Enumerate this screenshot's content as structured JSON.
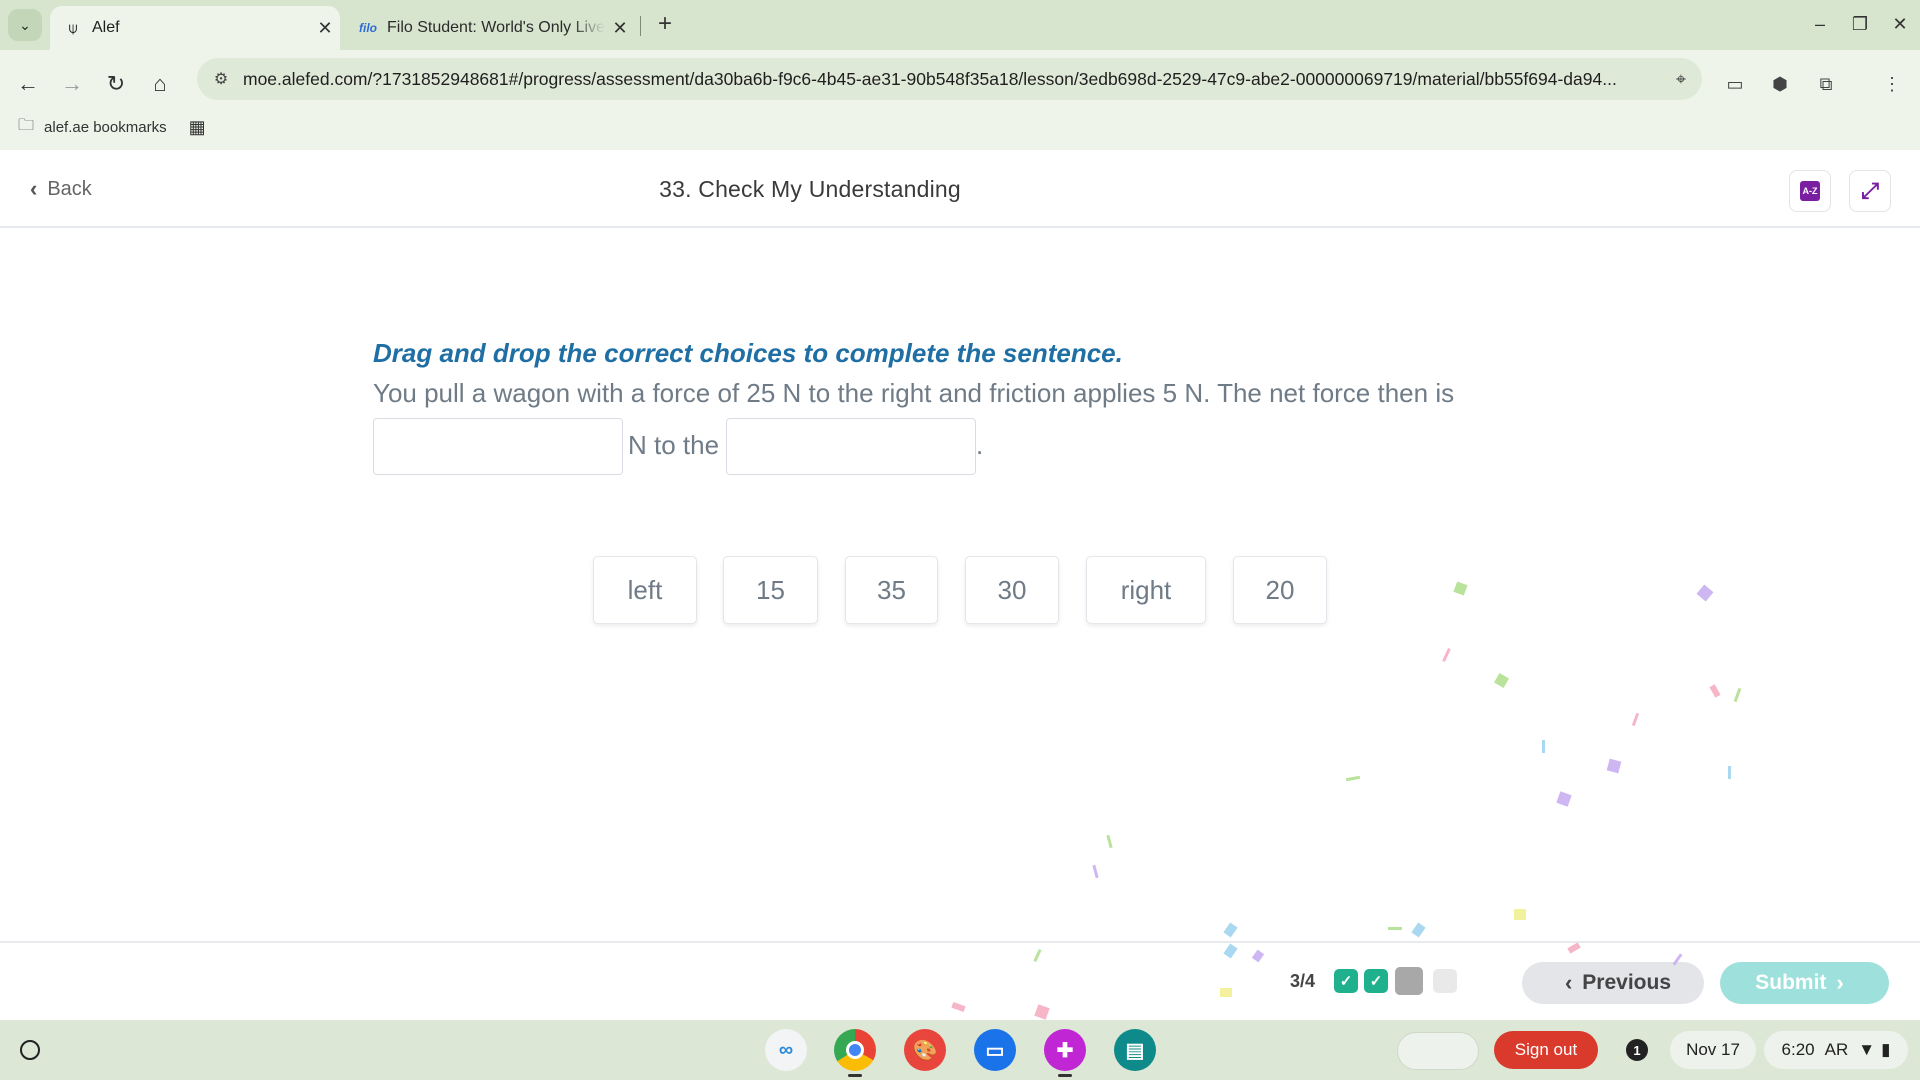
{
  "browser": {
    "tabs": [
      {
        "title": "Alef",
        "favicon": "alef-icon",
        "active": true
      },
      {
        "title": "Filo Student: World's Only Live",
        "favicon_text": "filo",
        "active": false
      }
    ],
    "url": "moe.alefed.com/?1731852948681#/progress/assessment/da30ba6b-f9c6-4b45-ae31-90b548f35a18/lesson/3edb698d-2529-47c9-abe2-000000069719/material/bb55f694-da94...",
    "bookmarks_folder": "alef.ae bookmarks"
  },
  "header": {
    "back_label": "Back",
    "title": "33. Check My Understanding",
    "glossary_icon_text": "A-Z"
  },
  "question": {
    "instruction": "Drag and drop the correct choices to complete the sentence.",
    "sentence_part1": "You pull a wagon with a force of 25 N to the right and friction applies 5 N. The net force then is",
    "sentence_part2": "N to the",
    "sentence_end": ".",
    "choices": [
      "left",
      "15",
      "35",
      "30",
      "right",
      "20"
    ]
  },
  "footer": {
    "progress": "3/4",
    "progress_dots": [
      {
        "state": "correct",
        "color": "#1fb08e"
      },
      {
        "state": "correct",
        "color": "#1fb08e"
      },
      {
        "state": "current",
        "color": "#a8a8a8"
      },
      {
        "state": "pending",
        "color": "#e9e9e9"
      }
    ],
    "previous_label": "Previous",
    "submit_label": "Submit"
  },
  "shelf": {
    "sign_out_label": "Sign out",
    "notification_count": "1",
    "date": "Nov 17",
    "time": "6:20",
    "locale": "AR"
  }
}
